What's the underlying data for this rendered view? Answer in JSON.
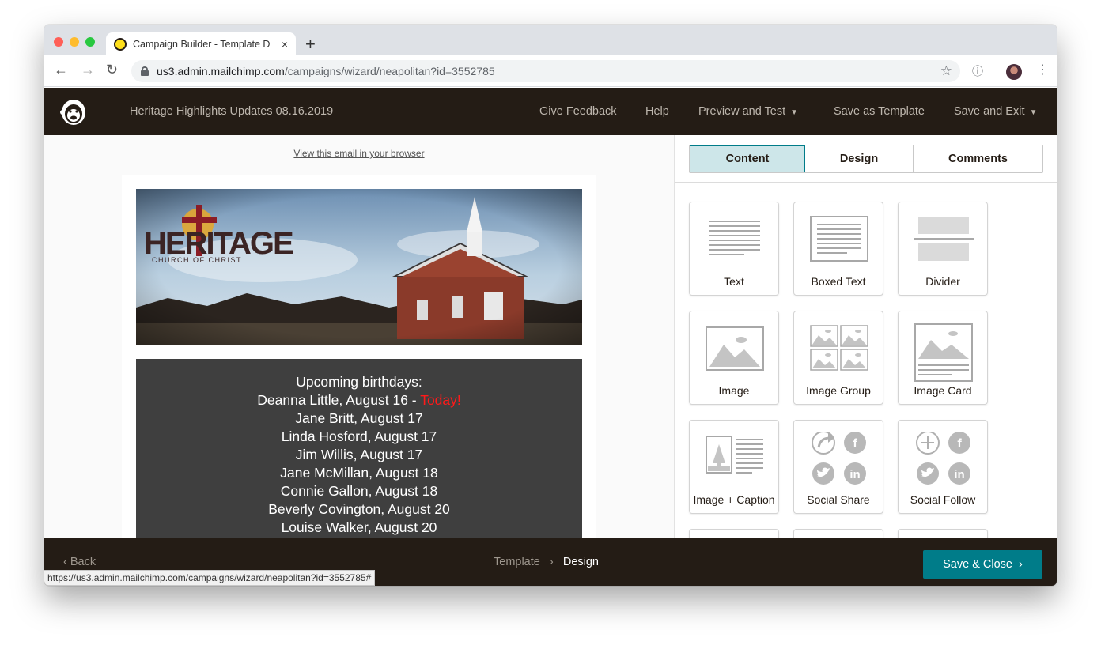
{
  "browser": {
    "tab_title": "Campaign Builder - Template D",
    "new_tab": "+",
    "tab_close": "×",
    "url_host": "us3.admin.mailchimp.com",
    "url_path": "/campaigns/wizard/neapolitan?id=3552785",
    "status_url": "https://us3.admin.mailchimp.com/campaigns/wizard/neapolitan?id=3552785#",
    "colors": {
      "close": "#ff5f57",
      "minimize": "#febc2e",
      "maximize": "#28c840"
    }
  },
  "header": {
    "campaign_title": "Heritage Highlights Updates 08.16.2019",
    "nav": {
      "feedback": "Give Feedback",
      "help": "Help",
      "preview": "Preview and Test",
      "save_template": "Save as Template",
      "save_exit": "Save and Exit"
    }
  },
  "email": {
    "view_in_browser": "View this email in your browser",
    "logo_main": "HERITAGE",
    "logo_sub": "CHURCH OF CHRIST",
    "birthdays_title": "Upcoming birthdays:",
    "first_birthday": "Deanna Little, August 16 - ",
    "today_label": "Today!",
    "birthdays": [
      "Jane Britt, August 17",
      "Linda Hosford, August 17",
      "Jim Willis, August 17",
      "Jane McMillan, August 18",
      "Connie Gallon, August 18",
      "Beverly Covington, August 20",
      "Louise Walker, August 20"
    ]
  },
  "panel": {
    "tabs": [
      "Content",
      "Design",
      "Comments"
    ],
    "active_tab": "Content",
    "blocks": [
      "Text",
      "Boxed Text",
      "Divider",
      "Image",
      "Image Group",
      "Image Card",
      "Image + Caption",
      "Social Share",
      "Social Follow"
    ]
  },
  "footer": {
    "back": "Back",
    "crumb_prev": "Template",
    "crumb_current": "Design",
    "save_close": "Save & Close"
  },
  "accent_color": "#007c89",
  "header_color": "#241c15"
}
